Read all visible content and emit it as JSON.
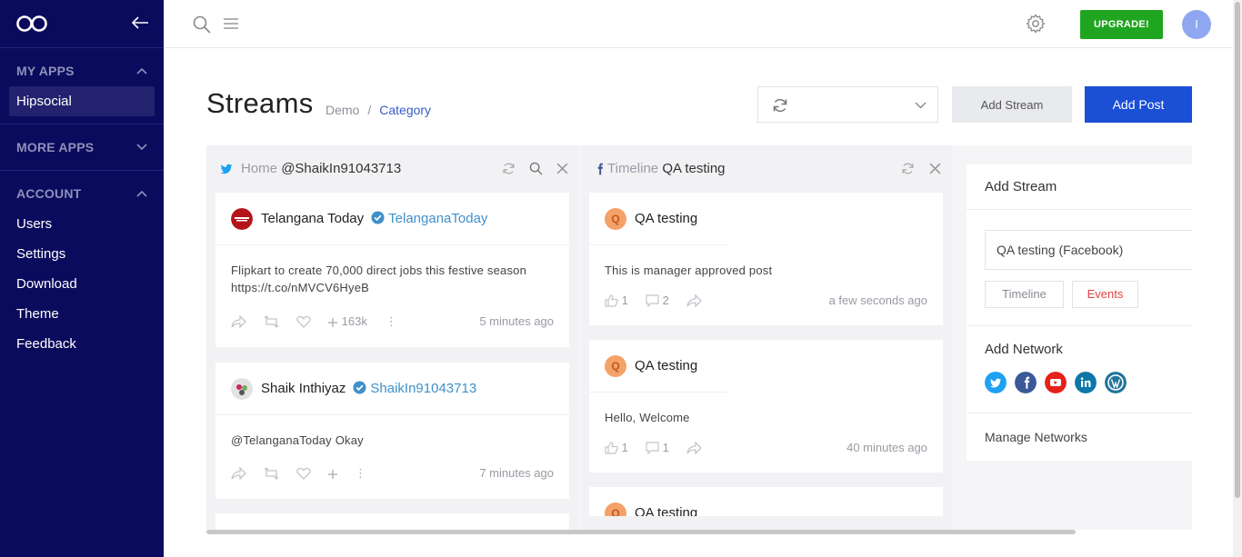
{
  "sidebar": {
    "my_apps": "MY APPS",
    "active_app": "Hipsocial",
    "more_apps": "MORE APPS",
    "account": "ACCOUNT",
    "items": [
      "Users",
      "Settings",
      "Download",
      "Theme",
      "Feedback"
    ]
  },
  "topbar": {
    "upgrade_label": "UPGRADE!",
    "avatar_letter": "I",
    "upgrade_color": "#1fa51f"
  },
  "header": {
    "title": "Streams",
    "breadcrumb": {
      "demo": "Demo",
      "sep": "/",
      "category": "Category"
    },
    "add_stream_label": "Add Stream",
    "add_post_label": "Add Post",
    "accent": "#1a4fd6"
  },
  "columns": [
    {
      "network": "twitter-icon",
      "type": "Home",
      "account": "@ShaikIn91043713",
      "cards": [
        {
          "name": "Telangana Today",
          "handle": "TelanganaToday",
          "text": "Flipkart to create 70,000 direct jobs this festive season https://t.co/nMVCV6HyeB",
          "count": "163k",
          "time": "5 minutes ago"
        },
        {
          "name": "Shaik Inthiyaz",
          "handle": "ShaikIn91043713",
          "text": "@TelanganaToday Okay",
          "count": "",
          "time": "7 minutes ago"
        }
      ]
    },
    {
      "network": "facebook-icon",
      "type": "Timeline",
      "account": "QA testing",
      "cards": [
        {
          "badge": "Q",
          "name": "QA testing",
          "text": "This is manager approved post",
          "likes": "1",
          "comments": "2",
          "time": "a few seconds ago"
        },
        {
          "badge": "Q",
          "name": "QA testing",
          "text": "Hello, Welcome",
          "likes": "1",
          "comments": "1",
          "time": "40 minutes ago"
        },
        {
          "badge": "Q",
          "name": "QA testing"
        }
      ]
    }
  ],
  "panel": {
    "add_stream": "Add Stream",
    "account_option": "QA testing (Facebook)",
    "timeline": "Timeline",
    "events": "Events",
    "add_network": "Add Network",
    "networks": [
      "twitter-icon",
      "facebook-icon",
      "youtube-icon",
      "linkedin-icon",
      "wordpress-icon"
    ],
    "manage": "Manage Networks"
  }
}
